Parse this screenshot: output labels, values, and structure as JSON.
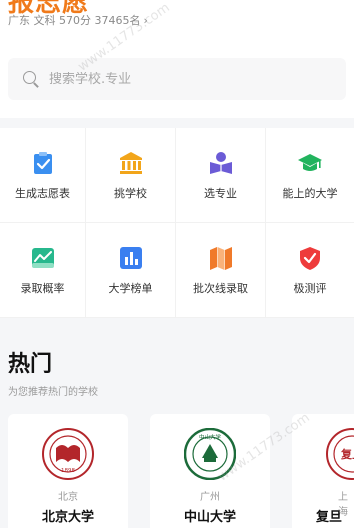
{
  "header": {
    "app_title": "报志愿",
    "user_info": "广东  文科 570分  37465名",
    "chevron": "›"
  },
  "search": {
    "placeholder": "搜索学校.专业"
  },
  "features": [
    {
      "label": "生成志愿表",
      "icon": "clipboard-check-icon",
      "color": "#3a8ff0"
    },
    {
      "label": "挑学校",
      "icon": "building-columns-icon",
      "color": "#f2a51a"
    },
    {
      "label": "选专业",
      "icon": "book-reader-icon",
      "color": "#6b5bd6"
    },
    {
      "label": "能上的大学",
      "icon": "graduation-cap-icon",
      "color": "#22b35e"
    },
    {
      "label": "录取概率",
      "icon": "trend-chart-icon",
      "color": "#27b88d"
    },
    {
      "label": "大学榜单",
      "icon": "bar-chart-icon",
      "color": "#3a7ff0"
    },
    {
      "label": "批次线录取",
      "icon": "map-icon",
      "color": "#f07a2a"
    },
    {
      "label": "极测评",
      "icon": "shield-check-icon",
      "color": "#ee3b3b"
    }
  ],
  "hot": {
    "title": "热门",
    "subtitle": "为您推荐热门的学校",
    "schools": [
      {
        "city": "北京",
        "name": "北京大学",
        "logo": "peking-university-seal-icon",
        "color": "#b3262b",
        "logo_text": "1898"
      },
      {
        "city": "广州",
        "name": "中山大学",
        "logo": "sun-yat-sen-university-seal-icon",
        "color": "#1c6b3a",
        "logo_text": "中山大学"
      },
      {
        "city": "上海",
        "name": "复旦大学",
        "logo": "fudan-university-seal-icon",
        "color": "#b3262b",
        "logo_text": "复旦"
      }
    ]
  },
  "watermark": "www.11773.com"
}
